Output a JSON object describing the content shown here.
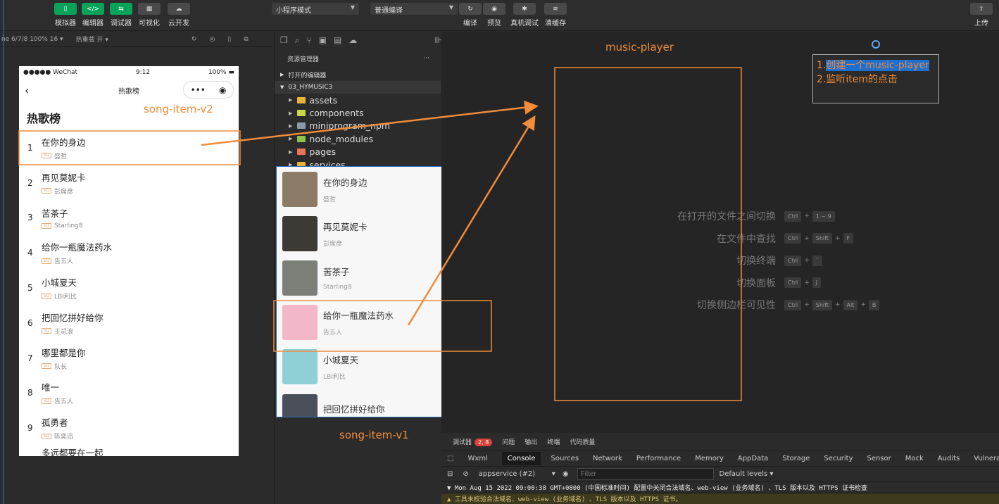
{
  "toolbar": {
    "buttons": [
      "模拟器",
      "编辑器",
      "调试器",
      "可视化",
      "云开发"
    ],
    "mode_select": "小程序模式",
    "compile_select": "普通编译",
    "actions": [
      "编译",
      "预览",
      "真机调试",
      "清缓存"
    ],
    "upload": "上传"
  },
  "simulator": {
    "device_info": "ne 6/7/8 100% 16 ▾",
    "hot_reload": "热重载 开 ▾",
    "status_left": "●●●●● WeChat",
    "status_time": "9:12",
    "status_battery": "100%",
    "nav_title": "热歌榜",
    "page_title": "热歌榜",
    "songs": [
      {
        "idx": "1",
        "name": "在你的身边",
        "artist": "盛哲"
      },
      {
        "idx": "2",
        "name": "再见莫妮卡",
        "artist": "彭席彦"
      },
      {
        "idx": "3",
        "name": "苦茶子",
        "artist": "Starling8"
      },
      {
        "idx": "4",
        "name": "给你一瓶魔法药水",
        "artist": "告五人"
      },
      {
        "idx": "5",
        "name": "小城夏天",
        "artist": "LBI利比"
      },
      {
        "idx": "6",
        "name": "把回忆拼好给你",
        "artist": "王贰浪"
      },
      {
        "idx": "7",
        "name": "哪里都是你",
        "artist": "队长"
      },
      {
        "idx": "8",
        "name": "唯一",
        "artist": "告五人"
      },
      {
        "idx": "9",
        "name": "孤勇者",
        "artist": "陈奕迅"
      }
    ],
    "partial_row": "多远都要在一起"
  },
  "explorer": {
    "header": "资源管理器",
    "open_editors": "打开的编辑器",
    "project": "03_HYMUSIC3",
    "tree": [
      {
        "name": "assets",
        "color": "#e8b339"
      },
      {
        "name": "components",
        "color": "#c7d84a"
      },
      {
        "name": "miniprogram_npm",
        "color": "#8a9aa8"
      },
      {
        "name": "node_modules",
        "color": "#8ec24a"
      },
      {
        "name": "pages",
        "color": "#e6765a"
      },
      {
        "name": "services",
        "color": "#e8b339"
      }
    ]
  },
  "overlay": {
    "songs": [
      {
        "name": "在你的身边",
        "artist": "盛哲",
        "cover": "#8b7a66"
      },
      {
        "name": "再见莫妮卡",
        "artist": "彭席彦",
        "cover": "#3d3a36"
      },
      {
        "name": "苦茶子",
        "artist": "Starling8",
        "cover": "#7a7f78"
      },
      {
        "name": "给你一瓶魔法药水",
        "artist": "告五人",
        "cover": "#f2b8c8"
      },
      {
        "name": "小城夏天",
        "artist": "LBI利比",
        "cover": "#8fd0d6"
      },
      {
        "name": "把回忆拼好给你",
        "artist": "",
        "cover": "#4a4f5a"
      }
    ]
  },
  "annotations": {
    "song_item_v2": "song-item-v2",
    "song_item_v1": "song-item-v1",
    "music_player": "music-player",
    "note_line1_prefix": "1.",
    "note_line1_selected": "创建一个music-player",
    "note_line2": "2.监听item的点击"
  },
  "shortcuts": [
    {
      "label": "在打开的文件之间切换",
      "keys": [
        "Ctrl",
        "+",
        "1 ~ 9"
      ]
    },
    {
      "label": "在文件中查找",
      "keys": [
        "Ctrl",
        "+",
        "Shift",
        "+",
        "F"
      ]
    },
    {
      "label": "切换终端",
      "keys": [
        "Ctrl",
        "+",
        "`"
      ]
    },
    {
      "label": "切换面板",
      "keys": [
        "Ctrl",
        "+",
        "J"
      ]
    },
    {
      "label": "切换侧边栏可见性",
      "keys": [
        "Ctrl",
        "+",
        "Shift",
        "+",
        "Alt",
        "+",
        "B"
      ]
    }
  ],
  "console": {
    "tabs": [
      "调试器",
      "问题",
      "输出",
      "终端",
      "代码质量"
    ],
    "badge": "2, 8",
    "devtools": [
      "Wxml",
      "Console",
      "Sources",
      "Network",
      "Performance",
      "Memory",
      "AppData",
      "Storage",
      "Security",
      "Sensor",
      "Mock",
      "Audits",
      "Vulnerability"
    ],
    "context": "appservice (#2)",
    "filter_placeholder": "Filter",
    "levels": "Default levels ▾",
    "log1": "▼ Mon Aug 15 2022 09:00:38 GMT+0800 (中国标准时间) 配置中关闭合法域名、web-view (业务域名) 、TLS 版本以及 HTTPS 证书检查",
    "log2": "▲ 工具未校验合法域名、web-view (业务域名) 、TLS 版本以及 HTTPS 证书。"
  },
  "colors": {
    "accent": "#07a35a",
    "annotation": "#f08c3a",
    "selection": "#1e6fcf"
  }
}
